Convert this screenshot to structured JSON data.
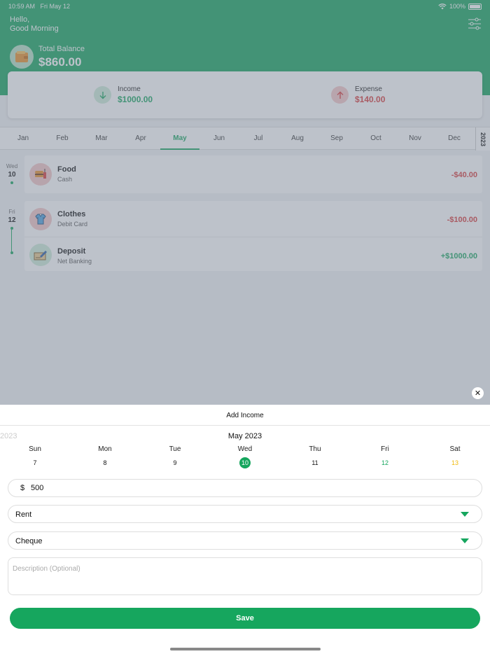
{
  "status_bar": {
    "time": "10:59 AM",
    "date": "Fri May 12",
    "battery": "100%"
  },
  "header": {
    "greeting_line1": "Hello,",
    "greeting_line2": "Good Morning"
  },
  "balance": {
    "label": "Total Balance",
    "value": "$860.00"
  },
  "summary": {
    "income_label": "Income",
    "income_value": "$1000.00",
    "expense_label": "Expense",
    "expense_value": "$140.00"
  },
  "months": [
    "Jan",
    "Feb",
    "Mar",
    "Apr",
    "May",
    "Jun",
    "Jul",
    "Aug",
    "Sep",
    "Oct",
    "Nov",
    "Dec"
  ],
  "selected_month": "May",
  "year": "2023",
  "days": [
    {
      "dow": "Wed",
      "day": "10"
    },
    {
      "dow": "Fri",
      "day": "12"
    }
  ],
  "transactions": [
    {
      "name": "Food",
      "method": "Cash",
      "amount": "-$40.00",
      "icon": "food-icon"
    },
    {
      "name": "Clothes",
      "method": "Debit Card",
      "amount": "-$100.00",
      "icon": "shirt-icon"
    },
    {
      "name": "Deposit",
      "method": "Net Banking",
      "amount": "+$1000.00",
      "icon": "cheque-icon"
    }
  ],
  "modal": {
    "title": "Add Income",
    "close": "✕",
    "calendar_month": "May 2023",
    "calendar_prev": "2023",
    "weekdays": [
      "Sun",
      "Mon",
      "Tue",
      "Wed",
      "Thu",
      "Fri",
      "Sat"
    ],
    "dates": [
      "7",
      "8",
      "9",
      "10",
      "11",
      "12",
      "13"
    ],
    "selected_date": "10",
    "currency": "$",
    "amount": "500",
    "category": "Rent",
    "payment_method": "Cheque",
    "description_placeholder": "Description (Optional)",
    "save_label": "Save"
  },
  "colors": {
    "brand": "#16a65e",
    "expense": "#d83a3a",
    "saturday": "#f0b90b"
  }
}
